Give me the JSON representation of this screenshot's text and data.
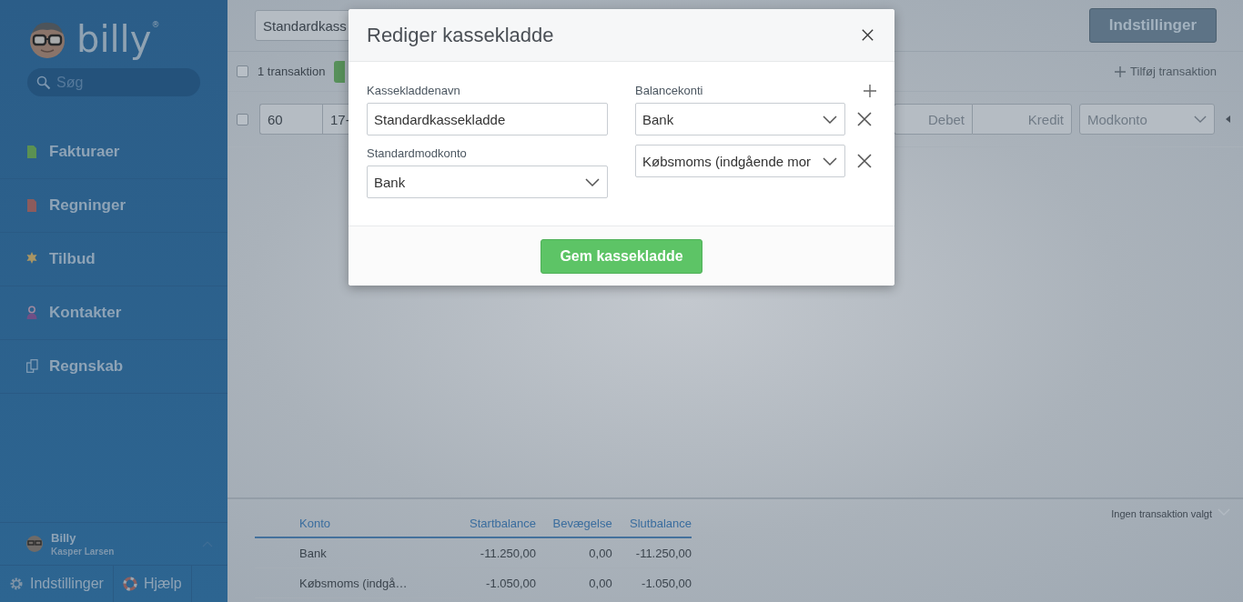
{
  "sidebar": {
    "logo": "billy$^{®}$",
    "search": {
      "placeholder": "Søg"
    },
    "nav": [
      {
        "label": "Fakturaer",
        "kind": "invoice"
      },
      {
        "label": "Regninger",
        "kind": "bill"
      },
      {
        "label": "Tilbud",
        "kind": "quote"
      },
      {
        "label": "Kontakter",
        "kind": "contact"
      },
      {
        "label": "Regnskab",
        "kind": "accounting"
      }
    ],
    "user": {
      "name": "Billy",
      "company": "Kasper Larsen"
    },
    "footer_links": [
      {
        "label": "Indstillinger",
        "kind": "settings"
      },
      {
        "label": "Hjælp",
        "kind": "help"
      }
    ]
  },
  "toolbar": {
    "journal_field": "Standardkass",
    "settings_button": "Indstillinger"
  },
  "list_bar": {
    "select_all_checked": false,
    "count": "1 transaktion",
    "add_link": "Tilføj transaktion"
  },
  "transaction_row": {
    "checked": false,
    "number": "60",
    "date": "17-",
    "debit_placeholder": "Debet",
    "credit_placeholder": "Kredit",
    "account_placeholder": "Modkonto"
  },
  "balance_table": {
    "columns": [
      "Konto",
      "Startbalance",
      "Bevægelse",
      "Slutbalance"
    ],
    "rows": [
      [
        "Bank",
        "-11.250,00",
        "0,00",
        "-11.250,00"
      ],
      [
        "Købsmoms (indgå…",
        "-1.050,00",
        "0,00",
        "-1.050,00"
      ]
    ]
  },
  "detail_status": "Ingen transaktion valgt",
  "modal": {
    "title": "Rediger kassekladde",
    "name_label": "Kassekladdenavn",
    "name_value": "Standardkassekladde",
    "contra_label": "Standardmodkonto",
    "contra_value": "Bank",
    "balance_label": "Balancekonti",
    "balance_accounts": [
      "Bank",
      "Købsmoms (indgående mor"
    ],
    "save_button": "Gem kassekladde"
  }
}
